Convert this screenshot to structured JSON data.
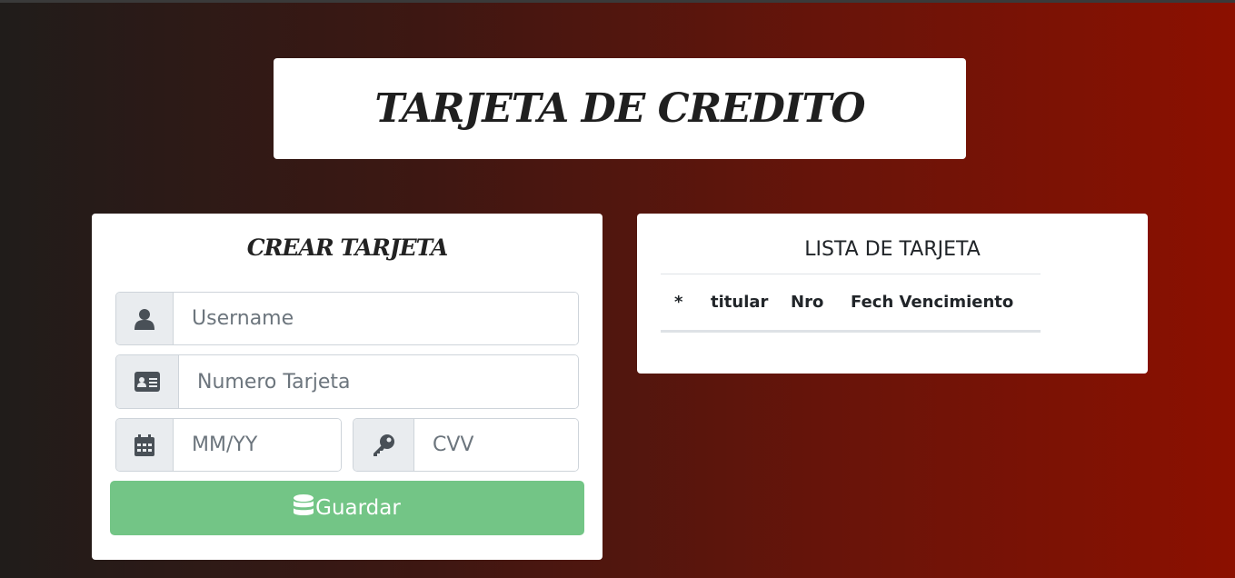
{
  "header": {
    "title": "TARJETA DE CREDITO"
  },
  "form": {
    "title": "CREAR TARJETA",
    "username": {
      "placeholder": "Username",
      "icon": "user-icon"
    },
    "card_number": {
      "placeholder": "Numero Tarjeta",
      "icon": "id-card-icon"
    },
    "expiry": {
      "placeholder": "MM/YY",
      "icon": "calendar-icon"
    },
    "cvv": {
      "placeholder": "CVV",
      "icon": "key-icon"
    },
    "save_label": "Guardar",
    "save_icon": "database-icon",
    "save_color": "#73c586"
  },
  "list": {
    "title": "LISTA DE TARJETA",
    "columns": [
      "*",
      "titular",
      "Nro",
      "Fech Vencimiento"
    ]
  }
}
